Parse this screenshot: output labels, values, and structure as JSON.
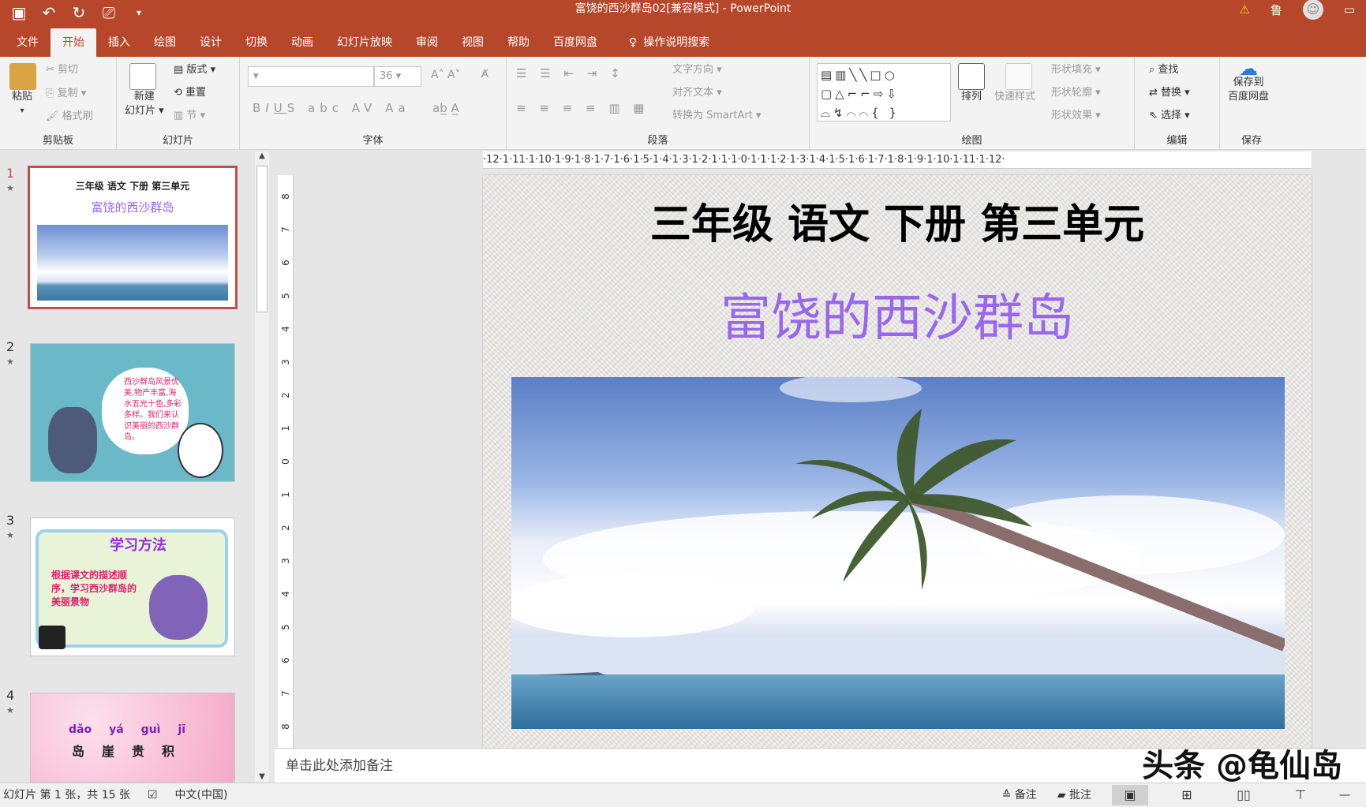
{
  "window": {
    "title": "富饶的西沙群岛02[兼容模式]  -  PowerPoint",
    "user_initial": "鲁"
  },
  "tabs": [
    "文件",
    "开始",
    "插入",
    "绘图",
    "设计",
    "切换",
    "动画",
    "幻灯片放映",
    "审阅",
    "视图",
    "帮助",
    "百度网盘"
  ],
  "tell_me": "操作说明搜索",
  "ribbon": {
    "clipboard": {
      "label": "剪贴板",
      "paste": "粘贴",
      "cut": "剪切",
      "copy": "复制",
      "format_painter": "格式刷"
    },
    "slides": {
      "label": "幻灯片",
      "new_slide": "新建",
      "new_slide2": "幻灯片",
      "layout": "版式",
      "reset": "重置",
      "section": "节"
    },
    "font": {
      "label": "字体",
      "size": "36"
    },
    "paragraph": {
      "label": "段落",
      "text_direction": "文字方向",
      "align_text": "对齐文本",
      "smartart": "转换为 SmartArt"
    },
    "drawing": {
      "label": "绘图",
      "arrange": "排列",
      "quick_styles": "快速样式",
      "shape_fill": "形状填充",
      "shape_outline": "形状轮廓",
      "shape_effects": "形状效果"
    },
    "editing": {
      "label": "编辑",
      "find": "查找",
      "replace": "替换",
      "select": "选择"
    },
    "save": {
      "label": "保存",
      "save_to": "保存到",
      "baidu": "百度网盘"
    }
  },
  "thumbnails": [
    {
      "num": "1",
      "title": "三年级 语文 下册 第三单元",
      "subtitle": "富饶的西沙群岛"
    },
    {
      "num": "2",
      "text": "西沙群岛风景优美,物产丰富,海水五光十色,多彩多样。我们来认识美丽的西沙群岛。"
    },
    {
      "num": "3",
      "title": "学习方法",
      "text": "根据课文的描述顺序，学习西沙群岛的美丽景物"
    },
    {
      "num": "4",
      "pinyin": [
        "dǎo",
        "yá",
        "guì",
        "jī"
      ],
      "chars": [
        "岛",
        "崖",
        "贵",
        "积"
      ]
    }
  ],
  "ruler": {
    "h": "·12·1·11·1·10·1·9·1·8·1·7·1·6·1·5·1·4·1·3·1·2·1·1·1·0·1·1·1·2·1·3·1·4·1·5·1·6·1·7·1·8·1·9·1·10·1·11·1·12·",
    "v": [
      "8",
      "7",
      "6",
      "5",
      "4",
      "3",
      "2",
      "1",
      "0",
      "1",
      "2",
      "3",
      "4",
      "5",
      "6",
      "7",
      "8"
    ]
  },
  "slide": {
    "title": "三年级 语文 下册 第三单元",
    "subtitle": "富饶的西沙群岛"
  },
  "notes": {
    "placeholder": "单击此处添加备注",
    "watermark": "头条 @龟仙岛"
  },
  "status": {
    "slide_info": "幻灯片 第 1 张，共 15 张",
    "language": "中文(中国)",
    "notes_btn": "备注",
    "comments_btn": "批注"
  }
}
